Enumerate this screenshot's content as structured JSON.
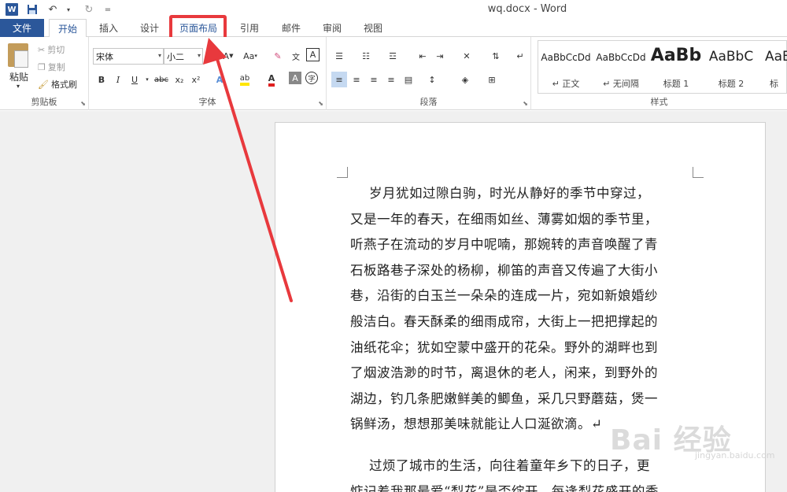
{
  "window": {
    "title": "wq.docx - Word"
  },
  "qat": {
    "undo_icon": "undo-icon",
    "redo_icon": "redo-icon",
    "save_icon": "save-icon",
    "more": "="
  },
  "tabs": [
    "文件",
    "开始",
    "插入",
    "设计",
    "页面布局",
    "引用",
    "邮件",
    "审阅",
    "视图"
  ],
  "clipboard": {
    "paste": "粘贴",
    "cut": "剪切",
    "copy": "复制",
    "format_painter": "格式刷",
    "label": "剪贴板"
  },
  "font": {
    "name": "宋体",
    "size": "小二",
    "label": "字体",
    "bold": "B",
    "italic": "I",
    "underline": "U",
    "strike": "abc",
    "sub": "x₂",
    "sup": "x²",
    "case": "Aa",
    "phonetic": "文",
    "border_char": "A",
    "circled": "字"
  },
  "paragraph": {
    "label": "段落"
  },
  "styles": {
    "label": "样式",
    "items": [
      {
        "sample": "AaBbCcDd",
        "name": "↵ 正文"
      },
      {
        "sample": "AaBbCcDd",
        "name": "↵ 无间隔"
      },
      {
        "sample": "AaBb",
        "name": "标题 1"
      },
      {
        "sample": "AaBbC",
        "name": "标题 2"
      },
      {
        "sample": "AaB",
        "name": "标"
      }
    ]
  },
  "document": {
    "paragraph1": [
      "岁月犹如过隙白驹，时光从静好的季节中穿过，",
      "又是一年的春天，在细雨如丝、薄雾如烟的季节里，",
      "听燕子在流动的岁月中呢喃，那婉转的声音唤醒了青",
      "石板路巷子深处的杨柳，柳笛的声音又传遍了大街小",
      "巷，沿街的白玉兰一朵朵的连成一片，宛如新娘婚纱",
      "般洁白。春天酥柔的细雨成帘，大街上一把把撑起的",
      "油纸花伞；犹如空蒙中盛开的花朵。野外的湖畔也到",
      "了烟波浩渺的时节，离退休的老人，闲来，到野外的",
      "湖边，钓几条肥嫩鲜美的鲫鱼，采几只野蘑菇，煲一",
      "锅鲜汤，想想那美味就能让人口涎欲滴。↵"
    ],
    "paragraph2": [
      "过烦了城市的生活，向往着童年乡下的日子，更",
      "惦记着我那最爱“梨花”是否绽开，每逢梨花盛开的季"
    ]
  },
  "watermark": {
    "text": "Bai 经验",
    "sub": "jingyan.baidu.com"
  },
  "colors": {
    "word_blue": "#2b579a",
    "highlight_red": "#e8393d"
  }
}
